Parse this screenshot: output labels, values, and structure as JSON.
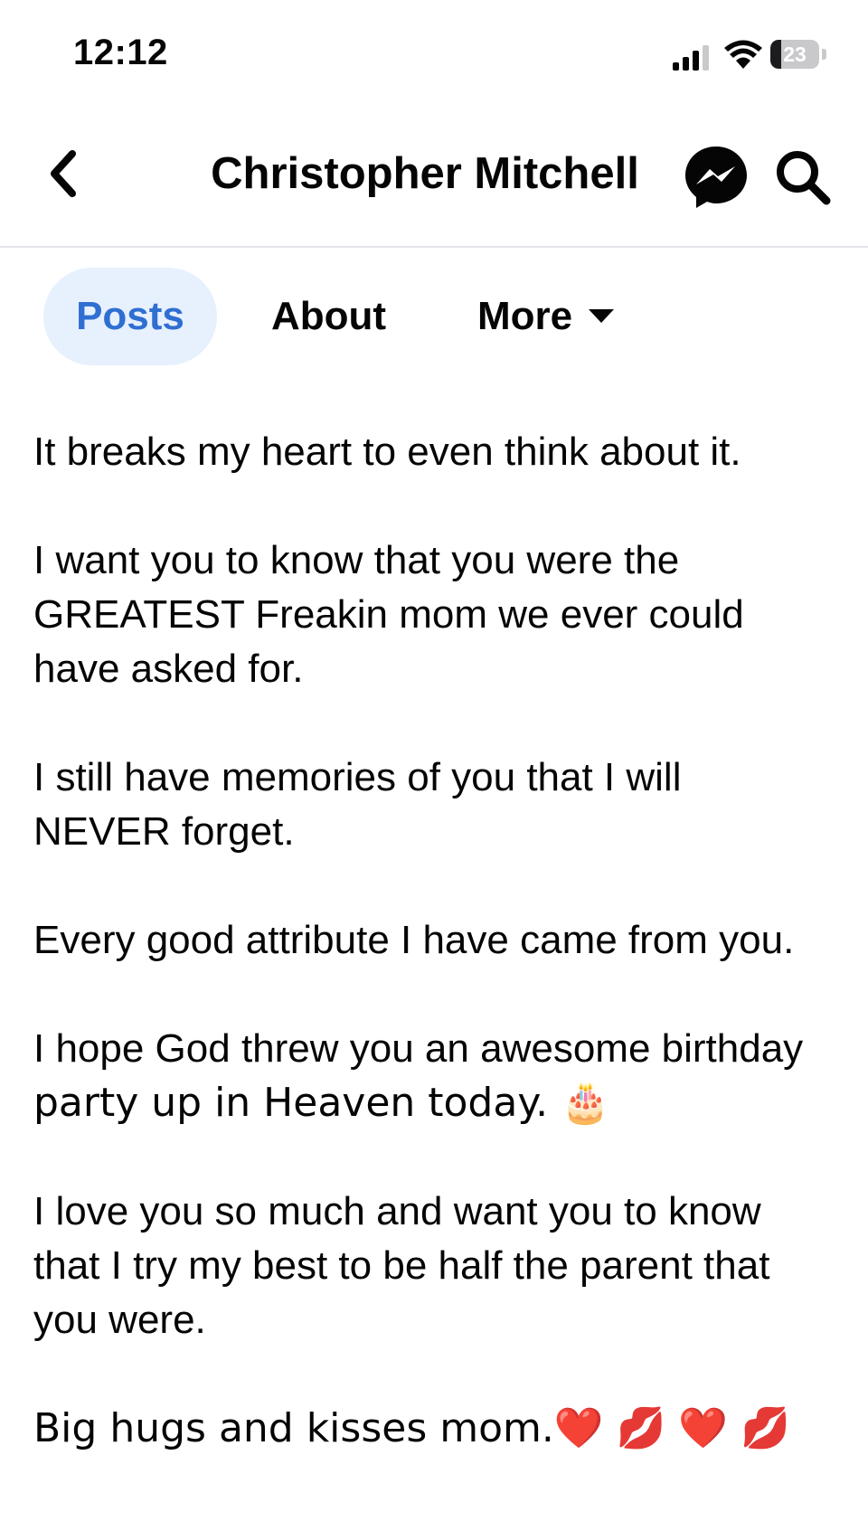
{
  "status_bar": {
    "time": "12:12",
    "battery_level": "23",
    "battery_fraction": 0.23
  },
  "header": {
    "title": "Christopher Mitchell",
    "icons": [
      "back-chevron-icon",
      "messenger-icon",
      "search-icon"
    ]
  },
  "tabs": [
    {
      "label": "Posts",
      "active": true
    },
    {
      "label": "About",
      "active": false
    },
    {
      "label": "More",
      "active": false
    }
  ],
  "post": {
    "paragraphs": [
      [
        "It breaks my heart to even think about it."
      ],
      [
        "I want you to know that you were the",
        "GREATEST Freakin mom we ever could",
        "have asked for."
      ],
      [
        "I still have memories of you that I will",
        "NEVER forget."
      ],
      [
        "Every good attribute I have came from you."
      ],
      [
        "I hope God threw you an awesome birthday",
        "party up in Heaven today. 🎂"
      ],
      [
        "I love you so much and want you to know",
        "that I try my best to be half the parent that",
        "you were."
      ],
      [
        "Big hugs and kisses mom.❤️ 💋 ❤️ 💋"
      ]
    ]
  },
  "colors": {
    "accent": "#2f6fd1",
    "active_tab_bg": "#e7f0fd",
    "text": "#050505",
    "divider": "#e4e6eb"
  }
}
